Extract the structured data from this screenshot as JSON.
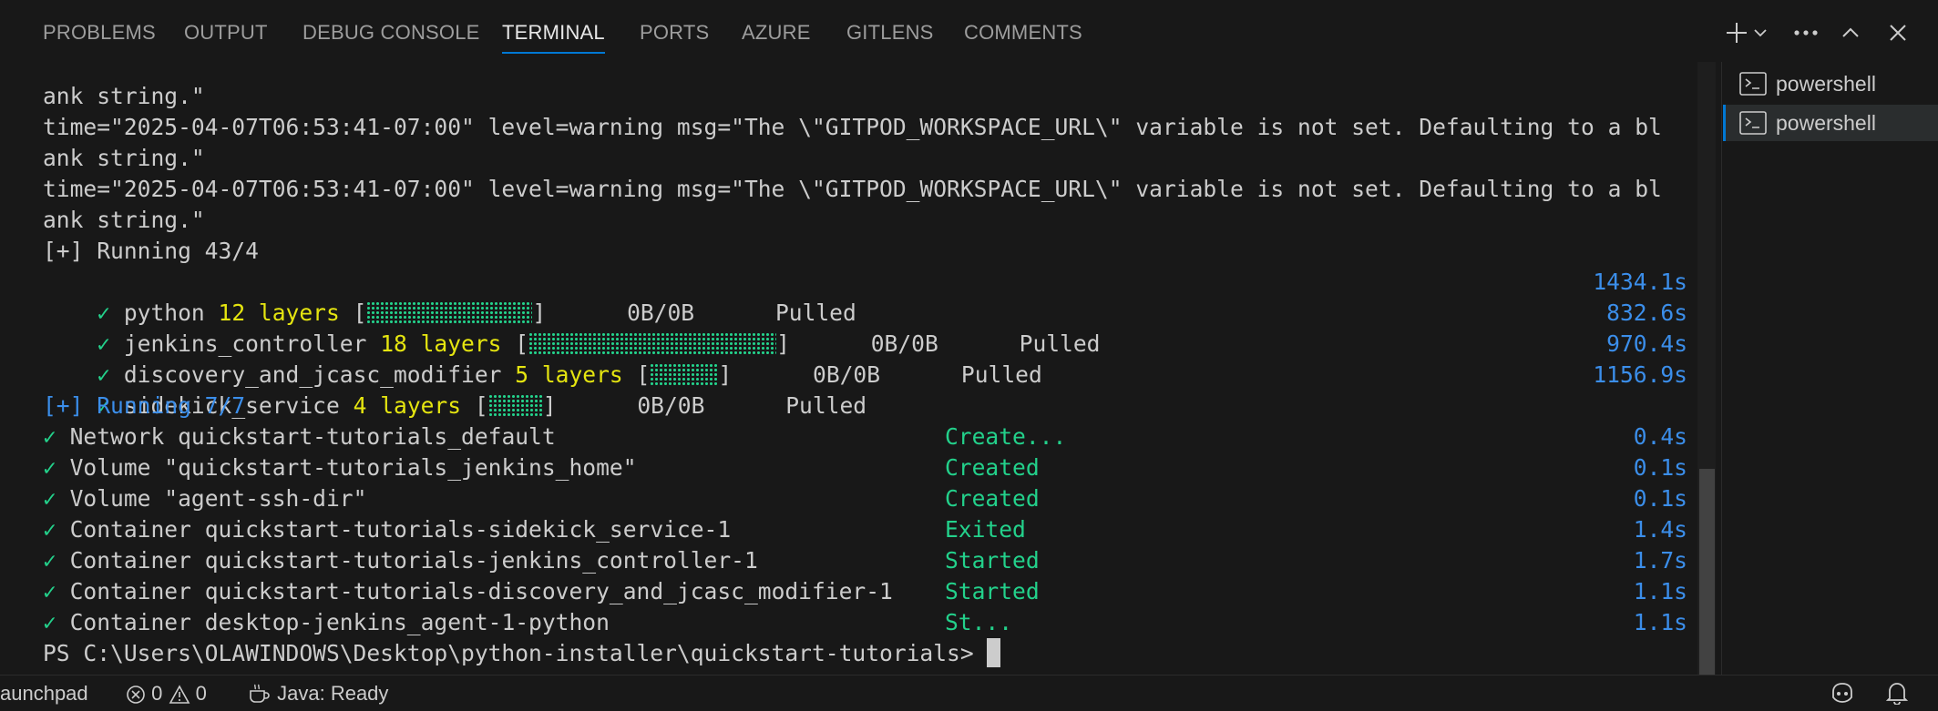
{
  "panel": {
    "tabs": [
      {
        "label": "PROBLEMS"
      },
      {
        "label": "OUTPUT"
      },
      {
        "label": "DEBUG CONSOLE"
      },
      {
        "label": "TERMINAL",
        "active": true
      },
      {
        "label": "PORTS"
      },
      {
        "label": "AZURE"
      },
      {
        "label": "GITLENS"
      },
      {
        "label": "COMMENTS"
      }
    ],
    "actions": [
      "plus-icon",
      "chevron-down-icon",
      "ellipsis-icon",
      "chevron-up-icon",
      "close-icon"
    ]
  },
  "terminal": {
    "warnings": [
      {
        "text": "ank string.\""
      },
      {
        "text": "time=\"2025-04-07T06:53:41-07:00\" level=warning msg=\"The \\\"GITPOD_WORKSPACE_URL\\\" variable is not set. Defaulting to a bl"
      },
      {
        "text": "ank string.\""
      },
      {
        "text": "time=\"2025-04-07T06:53:41-07:00\" level=warning msg=\"The \\\"GITPOD_WORKSPACE_URL\\\" variable is not set. Defaulting to a bl"
      },
      {
        "text": "ank string.\""
      }
    ],
    "pull_header": "[+] Running 43/4",
    "pulls": [
      {
        "check": "✓",
        "name": "python",
        "layers": "12 layers",
        "open": "[",
        "close": "]",
        "size": "0B/0B",
        "status": "Pulled",
        "time": "1434.1s",
        "progress": 1.0
      },
      {
        "check": "✓",
        "name": "jenkins_controller",
        "layers": "18 layers",
        "open": "[",
        "close": "]",
        "size": "0B/0B",
        "status": "Pulled",
        "time": "832.6s",
        "progress": 1.0
      },
      {
        "check": "✓",
        "name": "discovery_and_jcasc_modifier",
        "layers": "5 layers",
        "open": "[",
        "close": "]",
        "size": "0B/0B",
        "status": "Pulled",
        "time": "970.4s",
        "progress": 1.0
      },
      {
        "check": "✓",
        "name": "sidekick_service",
        "layers": "4 layers",
        "open": "[",
        "close": "]",
        "size": "0B/0B",
        "status": "Pulled",
        "time": "1156.9s",
        "progress": 1.0
      }
    ],
    "run_header": "[+] Running 7/7",
    "resources": [
      {
        "check": "✓",
        "name": "Network quickstart-tutorials_default",
        "status": "Create...",
        "time": "0.4s"
      },
      {
        "check": "✓",
        "name": "Volume \"quickstart-tutorials_jenkins_home\"",
        "status": "Created",
        "time": "0.1s"
      },
      {
        "check": "✓",
        "name": "Volume \"agent-ssh-dir\"",
        "status": "Created",
        "time": "0.1s"
      },
      {
        "check": "✓",
        "name": "Container quickstart-tutorials-sidekick_service-1",
        "status": "Exited",
        "time": "1.4s"
      },
      {
        "check": "✓",
        "name": "Container quickstart-tutorials-jenkins_controller-1",
        "status": "Started",
        "time": "1.7s"
      },
      {
        "check": "✓",
        "name": "Container quickstart-tutorials-discovery_and_jcasc_modifier-1",
        "status": "Started",
        "time": "1.1s"
      },
      {
        "check": "✓",
        "name": "Container desktop-jenkins_agent-1-python",
        "status": "St...",
        "time": "1.1s"
      }
    ],
    "prompt": "PS C:\\Users\\OLAWINDOWS\\Desktop\\python-installer\\quickstart-tutorials> "
  },
  "terminals_list": [
    {
      "label": "powershell",
      "icon": "terminal-icon",
      "selected": false
    },
    {
      "label": "powershell",
      "icon": "terminal-icon",
      "selected": true
    }
  ],
  "statusbar": {
    "launchpad": "aunchpad",
    "errors": "0",
    "warnings": "0",
    "java": "Java: Ready",
    "right_icons": [
      "copilot-icon",
      "bell-icon"
    ]
  },
  "colors": {
    "background": "#181818",
    "accent": "#0078d4",
    "ansi_green": "#23d18b",
    "ansi_yellow": "#e5e510",
    "ansi_blue": "#3b8eea"
  }
}
